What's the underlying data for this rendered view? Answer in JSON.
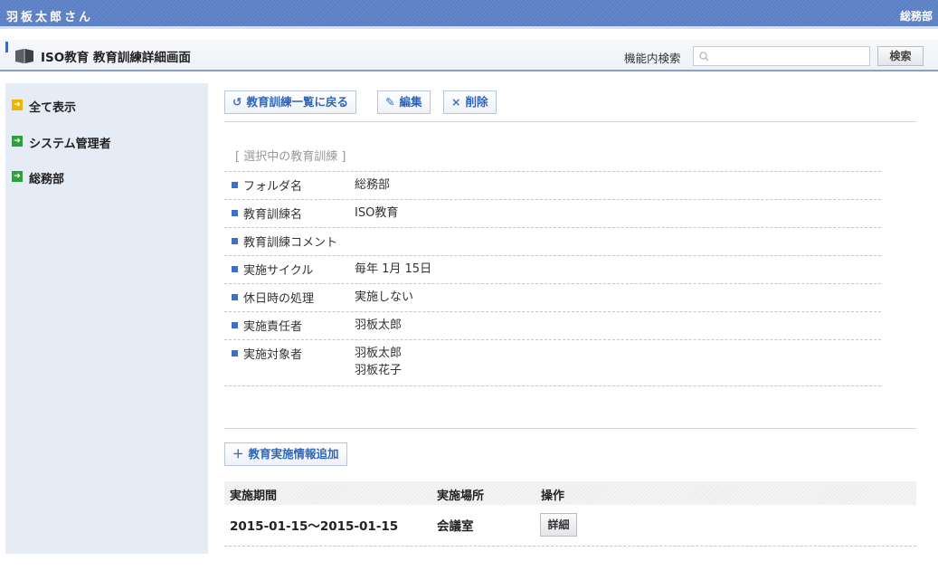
{
  "header": {
    "user_name": "羽板太郎さん",
    "department": "総務部"
  },
  "title_bar": {
    "page_title": "ISO教育 教育訓練詳細画面",
    "search_label": "機能内検索",
    "search_value": "",
    "search_placeholder": "",
    "search_button": "検索"
  },
  "sidebar": {
    "items": [
      {
        "label": "全て表示",
        "icon": "yellow-arrow-icon"
      },
      {
        "label": "システム管理者",
        "icon": "green-arrow-icon"
      },
      {
        "label": "総務部",
        "icon": "green-arrow-icon"
      }
    ]
  },
  "toolbar": {
    "back_label": "教育訓練一覧に戻る",
    "edit_label": "編集",
    "delete_label": "削除"
  },
  "detail": {
    "section_title": "[ 選択中の教育訓練 ]",
    "rows": [
      {
        "label": "フォルダ名",
        "values": [
          "総務部"
        ]
      },
      {
        "label": "教育訓練名",
        "values": [
          "ISO教育"
        ]
      },
      {
        "label": "教育訓練コメント",
        "values": []
      },
      {
        "label": "実施サイクル",
        "values": [
          "毎年 1月 15日"
        ]
      },
      {
        "label": "休日時の処理",
        "values": [
          "実施しない"
        ]
      },
      {
        "label": "実施責任者",
        "values": [
          "羽板太郎"
        ]
      },
      {
        "label": "実施対象者",
        "values": [
          "羽板太郎",
          "羽板花子"
        ]
      }
    ]
  },
  "implementation": {
    "add_label": "教育実施情報追加",
    "columns": [
      "実施期間",
      "実施場所",
      "操作"
    ],
    "rows": [
      {
        "period": "2015-01-15〜2015-01-15",
        "place": "会議室",
        "action": "詳細"
      }
    ]
  },
  "colors": {
    "header_blue": "#5a7fc4",
    "link_blue": "#2f64b7",
    "sidebar_bg": "#e6ecf6",
    "bullet_blue": "#3f6fc2"
  }
}
